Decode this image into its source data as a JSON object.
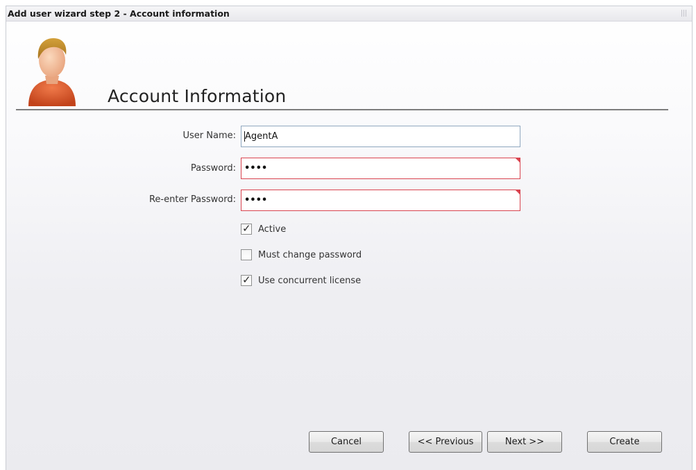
{
  "window": {
    "title": "Add user wizard step 2 - Account information"
  },
  "header": {
    "heading": "Account Information",
    "icon": "user-avatar-icon"
  },
  "form": {
    "username": {
      "label": "User Name:",
      "value": "AgentA"
    },
    "password": {
      "label": "Password:",
      "value": "••••",
      "invalid": true
    },
    "reenter_password": {
      "label": "Re-enter Password:",
      "value": "••••",
      "invalid": true
    },
    "checkboxes": [
      {
        "label": "Active",
        "checked": true
      },
      {
        "label": "Must change password",
        "checked": false
      },
      {
        "label": "Use concurrent license",
        "checked": true
      }
    ]
  },
  "buttons": {
    "cancel": "Cancel",
    "previous": "<< Previous",
    "next": "Next >>",
    "create": "Create"
  },
  "colors": {
    "invalid_border": "#d9434f",
    "field_border": "#8fa7bf"
  }
}
